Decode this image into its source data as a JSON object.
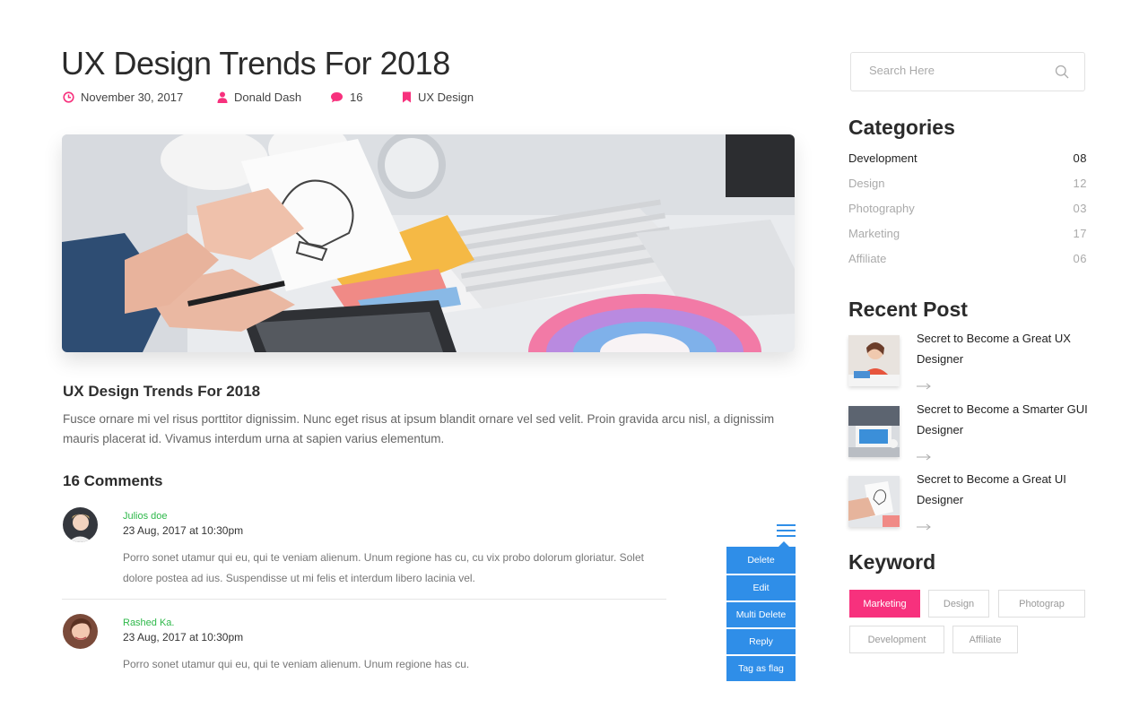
{
  "post": {
    "title": "UX Design Trends For 2018",
    "date": "November 30, 2017",
    "author": "Donald Dash",
    "comment_count": "16",
    "category": "UX Design",
    "subtitle": "UX Design Trends For 2018",
    "body": "Fusce ornare mi vel risus porttitor dignissim. Nunc eget risus at ipsum blandit ornare vel sed velit. Proin gravida arcu nisl, a dignissim mauris placerat id. Vivamus interdum urna at sapien varius elementum."
  },
  "comments": {
    "heading": "16 Comments",
    "items": [
      {
        "name": "Julios doe",
        "date": "23 Aug, 2017 at 10:30pm",
        "text": "Porro sonet utamur qui eu, qui te veniam alienum. Unum regione has cu, cu vix probo dolorum gloriatur. Solet dolore postea ad ius. Suspendisse ut mi felis et interdum libero lacinia vel."
      },
      {
        "name": "Rashed Ka.",
        "date": "23 Aug, 2017 at 10:30pm",
        "text": "Porro sonet utamur qui eu, qui te veniam alienum. Unum regione has cu."
      }
    ]
  },
  "action_menu": {
    "items": [
      "Delete",
      "Edit",
      "Multi Delete",
      "Reply",
      "Tag as flag"
    ]
  },
  "sidebar": {
    "search_placeholder": "Search Here",
    "categories_heading": "Categories",
    "categories": [
      {
        "name": "Development",
        "count": "08"
      },
      {
        "name": "Design",
        "count": "12"
      },
      {
        "name": "Photography",
        "count": "03"
      },
      {
        "name": "Marketing",
        "count": "17"
      },
      {
        "name": "Affiliate",
        "count": "06"
      }
    ],
    "recent_heading": "Recent Post",
    "recent_posts": [
      {
        "title": "Secret to Become a Great UX Designer"
      },
      {
        "title": "Secret to Become a Smarter GUI Designer"
      },
      {
        "title": "Secret to Become a Great UI Designer"
      }
    ],
    "keyword_heading": "Keyword",
    "keywords": [
      "Marketing",
      "Design",
      "Photograp",
      "Development",
      "Affiliate"
    ]
  },
  "colors": {
    "accent_pink": "#f7317d",
    "action_blue": "#2f8ee8",
    "commenter_green": "#2eb84a"
  }
}
